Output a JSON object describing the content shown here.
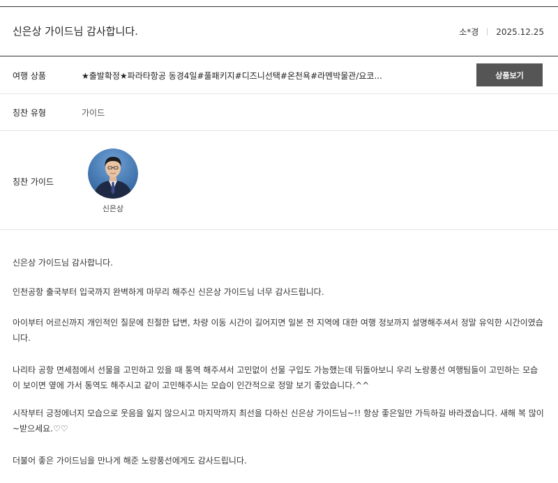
{
  "post": {
    "title": "신은상 가이드님 감사합니다.",
    "author": "소*경",
    "date": "2025.12.25"
  },
  "info": {
    "product_label": "여행 상품",
    "product_value": "★출발확정★파라타항공 동경4일#풀패키지#디즈니선택#온천욕#라멘박물관/요코...",
    "product_button": "상품보기",
    "type_label": "칭찬 유형",
    "type_value": "가이드",
    "guide_label": "칭찬 가이드",
    "guide_name": "신은상"
  },
  "body": {
    "p1": "신은상 가이드님 감사합니다.",
    "p2": "인천공항 출국부터 입국까지 완벽하게 마무리 해주신 신은상 가이드님 너무 감사드립니다.",
    "p3": "아이부터 어르신까지 개인적인 질문에 친절한 답변, 차량 이동 시간이 길어지면 일본 전 지역에 대한 여행 정보까지 설명해주셔서 정말 유익한 시간이였습니다.",
    "p4": "나리타 공항 면세점에서 선물을 고민하고 있을 때 통역 해주셔서 고민없이 선물 구입도 가능했는데 뒤돌아보니 우리 노랑풍선 여행팀들이 고민하는 모습이 보이면 옆에 가서 통역도 해주시고 같이 고민해주시는 모습이 인간적으로 정말 보기 좋았습니다.^^",
    "p5": "시작부터 긍정에너지 모습으로 웃음을 잃지 않으시고 마지막까지 최선을 다하신 신은상 가이드님~!! 항상 좋은일만 가득하길 바라겠습니다. 새해 복 많이~받으세요.♡♡",
    "p6": "더불어 좋은 가이드님을 만나게 해준 노랑풍선에게도 감사드립니다."
  },
  "colors": {
    "button_bg": "#555555",
    "rule_dark": "#333333",
    "rule_light": "#e5e5e5"
  }
}
